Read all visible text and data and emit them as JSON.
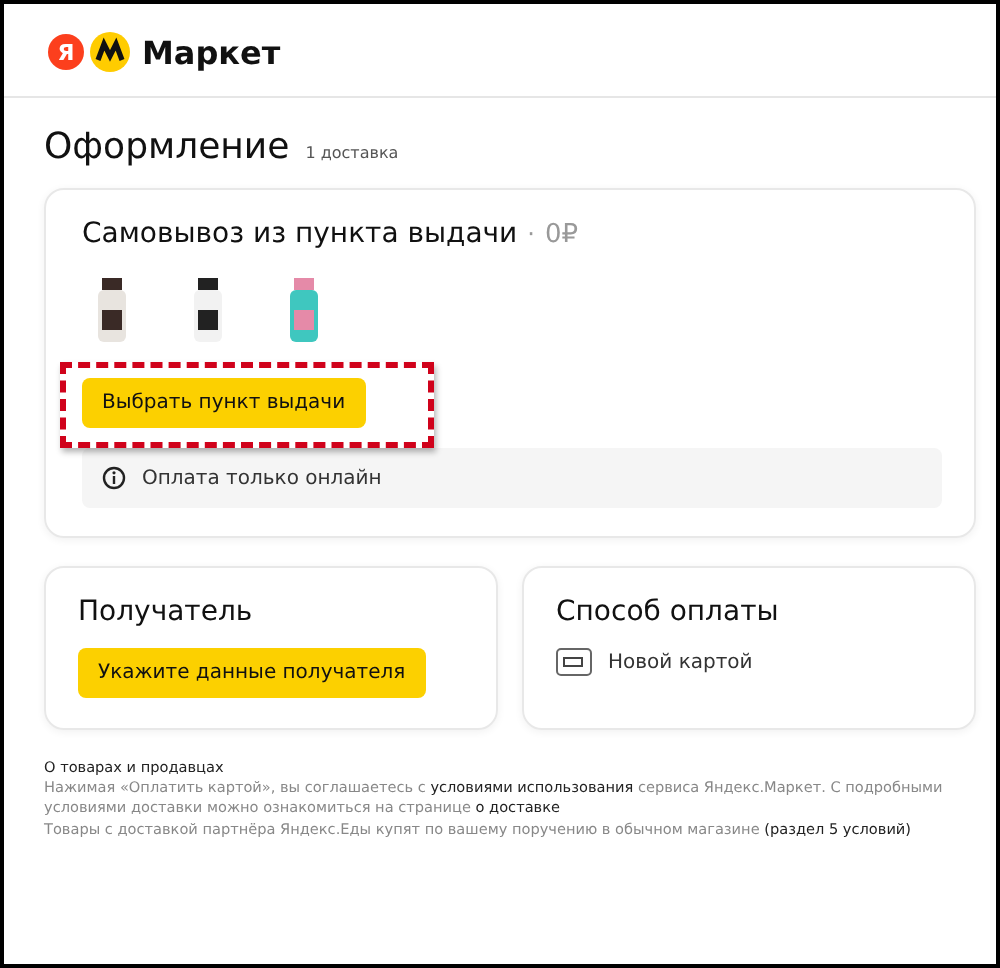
{
  "header": {
    "logo_letter": "Я",
    "logo_text": "Маркет"
  },
  "page": {
    "title": "Оформление",
    "subtitle": "1 доставка"
  },
  "delivery": {
    "title": "Самовывоз из пункта выдачи",
    "separator": "·",
    "price": "0₽",
    "button": "Выбрать пункт выдачи",
    "highlighted": true,
    "notice": "Оплата только онлайн"
  },
  "recipient": {
    "title": "Получатель",
    "button": "Укажите данные получателя"
  },
  "payment": {
    "title": "Способ оплаты",
    "method": "Новой картой"
  },
  "footer": {
    "heading": "О товарах и продавцах",
    "paragraphs": [
      {
        "parts": [
          {
            "text": "Нажимая «Оплатить картой», вы соглашаетесь с ",
            "link": false
          },
          {
            "text": "условиями использования",
            "link": true
          },
          {
            "text": " сервиса Яндекс.Маркет. С подробными условиями доставки можно ознакомиться на странице ",
            "link": false
          },
          {
            "text": "о доставке",
            "link": true
          }
        ]
      },
      {
        "parts": [
          {
            "text": "Товары с доставкой партнёра Яндекс.Еды купят по вашему поручению в обычном магазине ",
            "link": false
          },
          {
            "text": "(раздел 5 условий)",
            "link": true
          }
        ]
      }
    ]
  }
}
